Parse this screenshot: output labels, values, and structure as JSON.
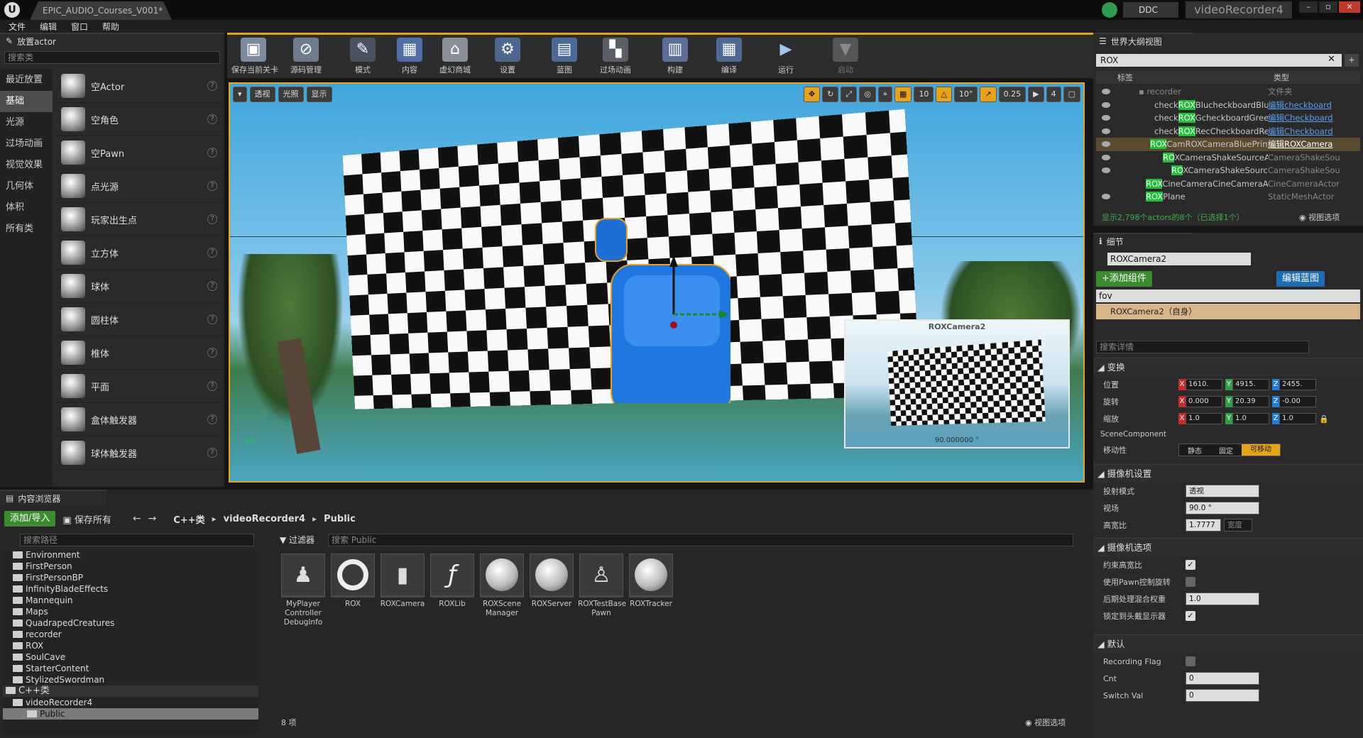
{
  "window": {
    "tab_title": "EPIC_AUDIO_Courses_V001*",
    "ddc_label": "DDC",
    "project_name": "videoRecorder4"
  },
  "menu": [
    "文件",
    "编辑",
    "窗口",
    "帮助"
  ],
  "place_actors": {
    "panel_title": "放置actor",
    "search_placeholder": "搜索类",
    "categories": [
      "最近放置",
      "基础",
      "光源",
      "过场动画",
      "视觉效果",
      "几何体",
      "体积",
      "所有类"
    ],
    "selected_category": "基础",
    "items": [
      "空Actor",
      "空角色",
      "空Pawn",
      "点光源",
      "玩家出生点",
      "立方体",
      "球体",
      "圆柱体",
      "椎体",
      "平面",
      "盒体触发器",
      "球体触发器"
    ]
  },
  "toolbar": [
    "保存当前关卡",
    "源码管理",
    "模式",
    "内容",
    "虚幻商城",
    "设置",
    "蓝图",
    "过场动画",
    "构建",
    "编译",
    "运行",
    "启动"
  ],
  "viewport": {
    "btn_perspective": "透视",
    "btn_lit": "光照",
    "btn_show": "显示",
    "grid_snap": "10",
    "rot_snap": "10°",
    "scale_snap": "0.25",
    "cam_speed": "4",
    "pip_title": "ROXCamera2",
    "pip_fov": "90.000000 °"
  },
  "outliner": {
    "panel_title": "世界大纲视图",
    "search_value": "ROX",
    "col_label": "标签",
    "col_type": "类型",
    "status": "显示2,798个actors的8个（已选择1个）",
    "view_options": "视图选项",
    "rows": [
      {
        "pre": "recorder",
        "hl": "",
        "post": "",
        "type": "文件夹",
        "link": false
      },
      {
        "pre": "check",
        "hl": "ROX",
        "post": "BlucheckboardBlue_C",
        "type": "编辑checkboard",
        "link": true
      },
      {
        "pre": "check",
        "hl": "ROX",
        "post": "GcheckboardGreen_C",
        "type": "编辑Checkboard",
        "link": true
      },
      {
        "pre": "check",
        "hl": "ROX",
        "post": "RecCheckboardRed_C",
        "type": "编辑Checkboard",
        "link": true
      },
      {
        "pre": "",
        "hl": "ROX",
        "post": "CamROXCameraBluePrint_C",
        "type": "编辑ROXCamera",
        "link": true
      },
      {
        "pre": "",
        "hl": "RO",
        "post": "XCameraShakeSourceActor",
        "type": "CameraShakeSou",
        "link": false
      },
      {
        "pre": "",
        "hl": "RO",
        "post": "XCameraShakeSourceActor",
        "type": "CameraShakeSou",
        "link": false
      },
      {
        "pre": "",
        "hl": "ROX",
        "post": "CineCameraCineCameraActor",
        "type": "CineCameraActor",
        "link": false
      },
      {
        "pre": "",
        "hl": "ROX",
        "post": "Plane",
        "type": "StaticMeshActor",
        "link": false
      }
    ]
  },
  "details": {
    "panel_title": "细节",
    "name_value": "ROXCamera2",
    "add_component": "+添加组件",
    "edit_blueprint": "编辑蓝图",
    "filter_value": "fov",
    "component_self": "ROXCamera2（自身）",
    "search_placeholder": "搜索详情",
    "transform": {
      "title": "变换",
      "location_label": "位置",
      "rotation_label": "旋转",
      "scale_label": "缩放",
      "location": [
        "1610.",
        "4915.",
        "2455."
      ],
      "rotation": [
        "0.000",
        "20.39",
        "-0.00"
      ],
      "scale": [
        "1.0",
        "1.0",
        "1.0"
      ]
    },
    "scene_component": "SceneComponent",
    "mobility_label": "移动性",
    "mobility": [
      "静态",
      "固定",
      "可移动"
    ],
    "camera_settings": {
      "title": "摄像机设置",
      "projection_label": "投射模式",
      "projection_value": "透视",
      "fov_label": "视场",
      "fov_value": "90.0 °",
      "aspect_label": "高宽比",
      "aspect_value": "1.7777",
      "aspect_extra": "宽度"
    },
    "camera_options": {
      "title": "摄像机选项",
      "constrain_label": "约束高宽比",
      "pawn_rot_label": "使用Pawn控制旋转",
      "pp_weight_label": "后期处理混合权重",
      "pp_weight_value": "1.0",
      "lock_hmd_label": "锁定到头戴显示器"
    },
    "default": {
      "title": "默认",
      "rec_flag_label": "Recording Flag",
      "cnt_label": "Cnt",
      "cnt_value": "0",
      "switch_label": "Switch Val",
      "switch_value": "0"
    }
  },
  "content_browser": {
    "panel_title": "内容浏览器",
    "add_import": "添加/导入",
    "save_all": "保存所有",
    "breadcrumb": [
      "C++类",
      "videoRecorder4",
      "Public"
    ],
    "path_search_placeholder": "搜索路径",
    "filter_label": "过滤器",
    "asset_search_placeholder": "搜索 Public",
    "tree": [
      "Environment",
      "FirstPerson",
      "FirstPersonBP",
      "InfinityBladeEffects",
      "Mannequin",
      "Maps",
      "QuadrapedCreatures",
      "recorder",
      "ROX",
      "SoulCave",
      "StarterContent",
      "StylizedSwordman"
    ],
    "tree_cpp": "C++类",
    "tree_project": "videoRecorder4",
    "tree_public": "Public",
    "assets": [
      "MyPlayer Controller DebugInfo",
      "ROX",
      "ROXCamera",
      "ROXLib",
      "ROXScene Manager",
      "ROXServer",
      "ROXTestBase Pawn",
      "ROXTracker"
    ],
    "count": "8 项",
    "view_options": "视图选项"
  }
}
